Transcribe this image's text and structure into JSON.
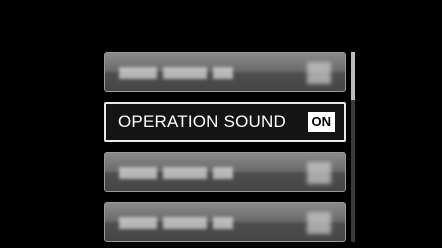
{
  "menu": {
    "items": [
      {
        "label": "",
        "state": "",
        "selected": false
      },
      {
        "label": "OPERATION SOUND",
        "state": "ON",
        "selected": true
      },
      {
        "label": "",
        "state": "",
        "selected": false
      },
      {
        "label": "",
        "state": "",
        "selected": false
      }
    ]
  },
  "scrollbar": {
    "position": 0.0,
    "visible_fraction": 0.25
  },
  "colors": {
    "background": "#000000",
    "item_inactive": "#6c6c6c",
    "item_active": "#141414",
    "item_border_active": "#e8e8e8",
    "text": "#ffffff"
  }
}
